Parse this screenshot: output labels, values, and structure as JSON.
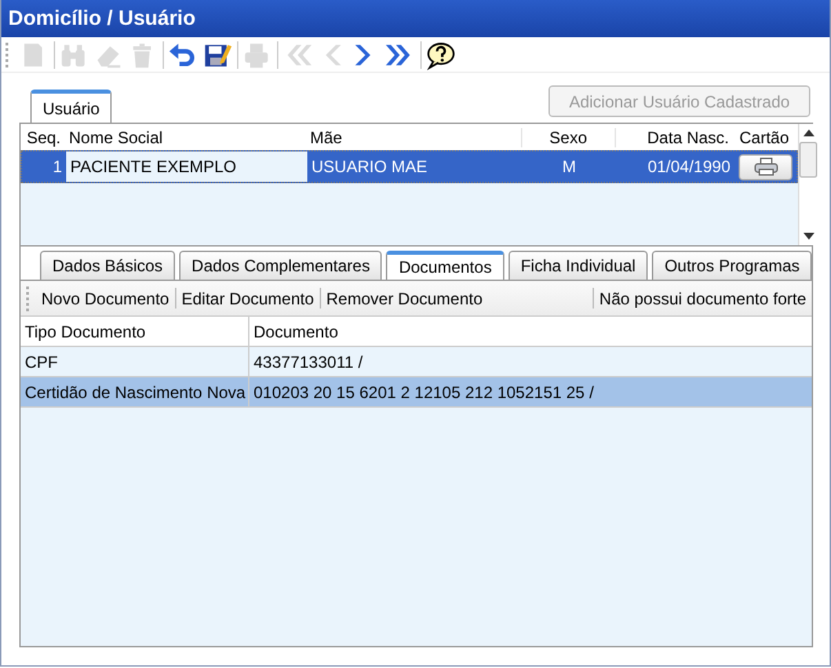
{
  "window": {
    "title": "Domicílio / Usuário"
  },
  "toolbar": [
    {
      "kind": "new",
      "disabled": true
    },
    {
      "kind": "find",
      "disabled": true
    },
    {
      "kind": "erase",
      "disabled": true
    },
    {
      "kind": "delete",
      "disabled": true
    },
    {
      "kind": "undo",
      "disabled": false
    },
    {
      "kind": "save",
      "disabled": false
    },
    {
      "kind": "print",
      "disabled": true
    },
    {
      "kind": "first",
      "disabled": true
    },
    {
      "kind": "prev",
      "disabled": true
    },
    {
      "kind": "next",
      "disabled": false
    },
    {
      "kind": "last",
      "disabled": false
    },
    {
      "kind": "help",
      "disabled": false
    }
  ],
  "user_tabs": [
    {
      "label": "Usuário",
      "selected": true
    }
  ],
  "add_button": {
    "label": "Adicionar Usuário Cadastrado",
    "disabled": true
  },
  "users_table": {
    "columns": [
      "Seq.",
      "Nome Social",
      "Mãe",
      "Sexo",
      "Data Nasc.",
      "Cartão"
    ],
    "rows": [
      {
        "cells": [
          "1",
          "PACIENTE EXEMPLO",
          "USUARIO MAE",
          "M",
          "01/04/1990"
        ],
        "selected": true
      }
    ]
  },
  "detail_tabs": [
    {
      "label": "Dados Básicos",
      "selected": false
    },
    {
      "label": "Dados Complementares",
      "selected": false
    },
    {
      "label": "Documentos",
      "selected": true
    },
    {
      "label": "Ficha Individual",
      "selected": false
    },
    {
      "label": "Outros Programas",
      "selected": false
    }
  ],
  "doc_actions": [
    "Novo Documento",
    "Editar Documento",
    "Remover Documento",
    "Não possui documento forte"
  ],
  "documents_table": {
    "columns": [
      "Tipo Documento",
      "Documento"
    ],
    "rows": [
      {
        "cells": [
          "CPF",
          "43377133011 /"
        ],
        "selected": false
      },
      {
        "cells": [
          "Certidão de Nascimento Nova",
          "010203 20 15 6201 2 12105 212 1052151 25 /"
        ],
        "selected": true
      }
    ]
  }
}
